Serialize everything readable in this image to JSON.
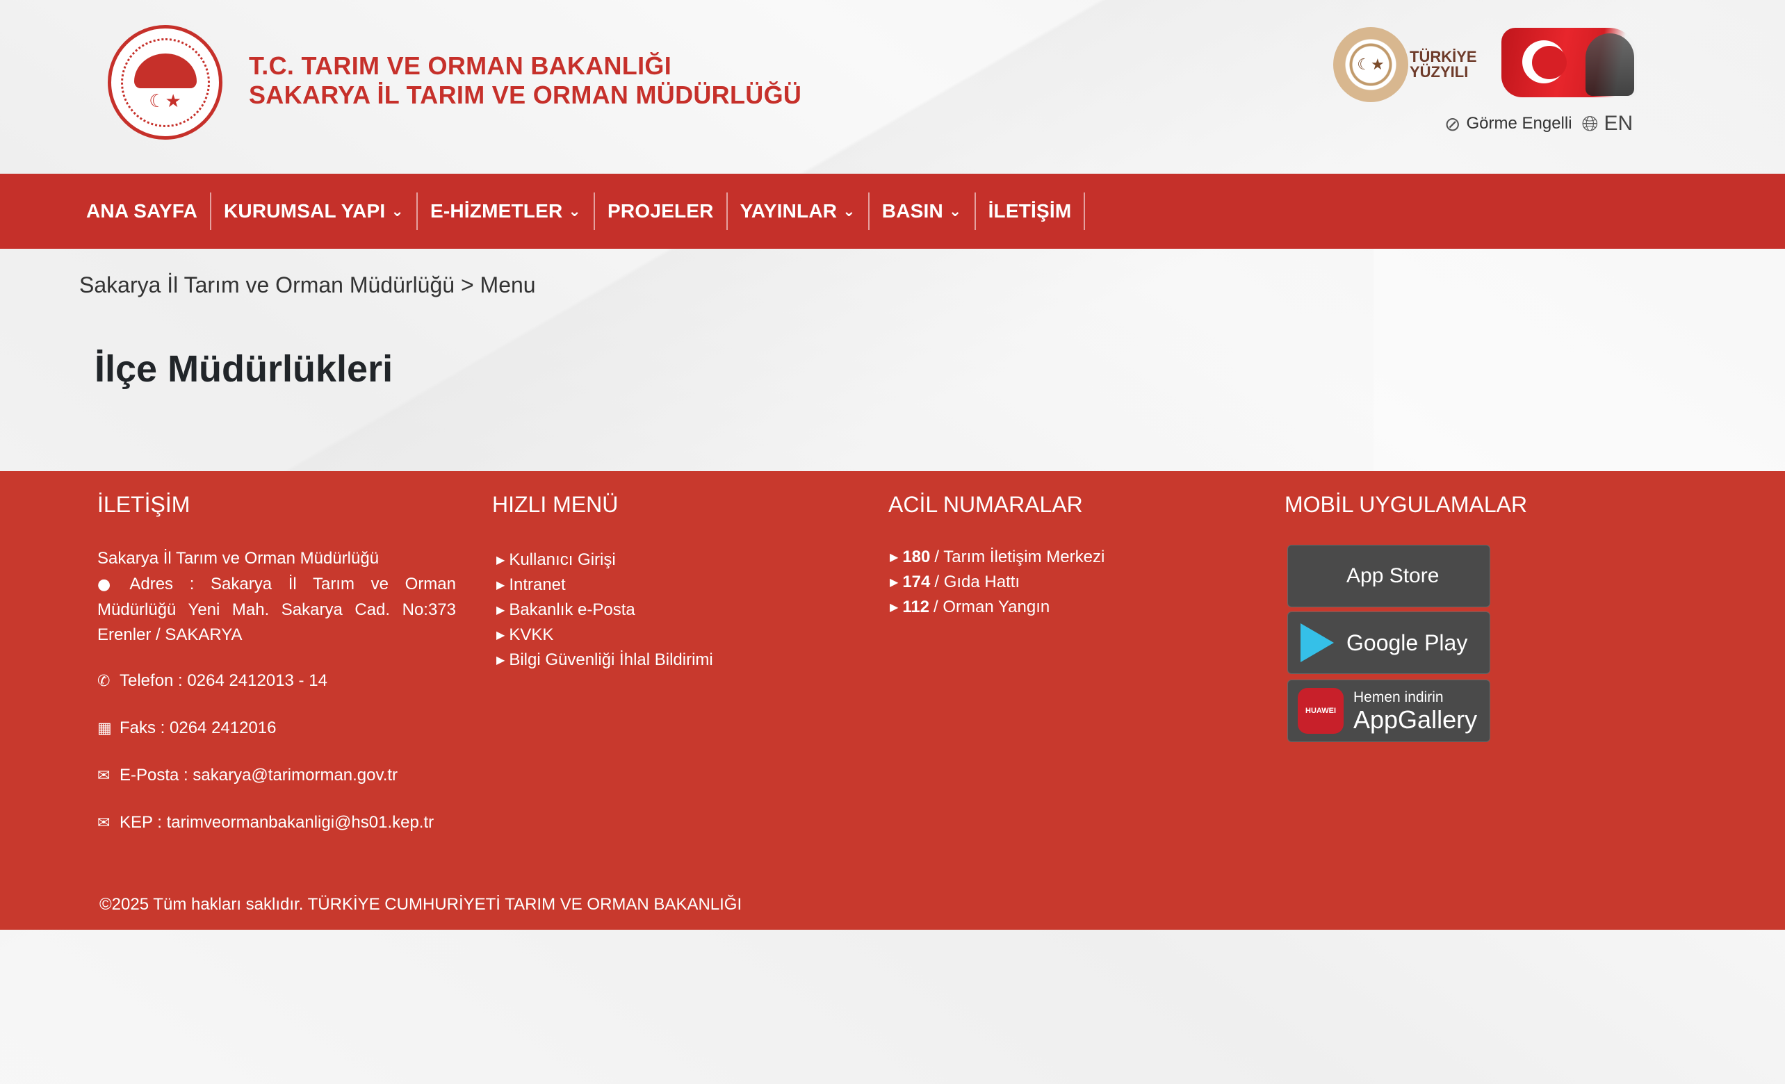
{
  "header": {
    "ministry_line1": "T.C. TARIM VE ORMAN BAKANLIĞI",
    "ministry_line2": "SAKARYA İL TARIM VE ORMAN MÜDÜRLÜĞÜ",
    "logo_icon": "ministry-seal-icon",
    "turkiye_yuzyili_line1": "TÜRKİYE",
    "turkiye_yuzyili_line2": "YÜZYILI",
    "accessibility_label": "Görme Engelli",
    "language_label": "EN"
  },
  "nav": {
    "items": [
      {
        "label": "ANA SAYFA",
        "dropdown": false
      },
      {
        "label": "KURUMSAL YAPI",
        "dropdown": true
      },
      {
        "label": "E-HİZMETLER",
        "dropdown": true
      },
      {
        "label": "PROJELER",
        "dropdown": false
      },
      {
        "label": "YAYINLAR",
        "dropdown": true
      },
      {
        "label": "BASIN",
        "dropdown": true
      },
      {
        "label": "İLETİŞİM",
        "dropdown": false
      }
    ]
  },
  "breadcrumb": {
    "root": "Sakarya İl Tarım ve Orman Müdürlüğü",
    "separator": ">",
    "current": "Menu"
  },
  "page": {
    "title": "İlçe Müdürlükleri"
  },
  "footer": {
    "contact": {
      "heading": "İLETİŞİM",
      "org": "Sakarya İl Tarım ve Orman Müdürlüğü",
      "address": "Adres : Sakarya İl Tarım ve Orman Müdürlüğü Yeni Mah. Sakarya Cad. No:373 Erenler / SAKARYA",
      "phone": "Telefon : 0264 2412013 - 14",
      "fax": "Faks : 0264 2412016",
      "email": "E-Posta : sakarya@tarimorman.gov.tr",
      "kep": "KEP : tarimveormanbakanligi@hs01.kep.tr"
    },
    "quick_menu": {
      "heading": "HIZLI MENÜ",
      "items": [
        "Kullanıcı Girişi",
        "Intranet",
        "Bakanlık e-Posta",
        "KVKK",
        "Bilgi Güvenliği İhlal Bildirimi"
      ]
    },
    "emergency": {
      "heading": "ACİL NUMARALAR",
      "items": [
        {
          "number": "180",
          "label": "/ Tarım İletişim Merkezi"
        },
        {
          "number": "174",
          "label": "/ Gıda Hattı"
        },
        {
          "number": "112",
          "label": "/ Orman Yangın"
        }
      ]
    },
    "mobile": {
      "heading": "MOBİL UYGULAMALAR",
      "app_store": "App Store",
      "google_play": "Google Play",
      "appgallery_small": "Hemen indirin",
      "appgallery_big": "AppGallery",
      "huawei_label": "HUAWEI"
    },
    "copyright": "©2025 Tüm hakları saklıdır. TÜRKİYE CUMHURİYETİ TARIM VE ORMAN BAKANLIĞI"
  },
  "colors": {
    "brand_red": "#c5302a",
    "footer_red": "#c8392d",
    "store_button": "#4a4a4a"
  }
}
